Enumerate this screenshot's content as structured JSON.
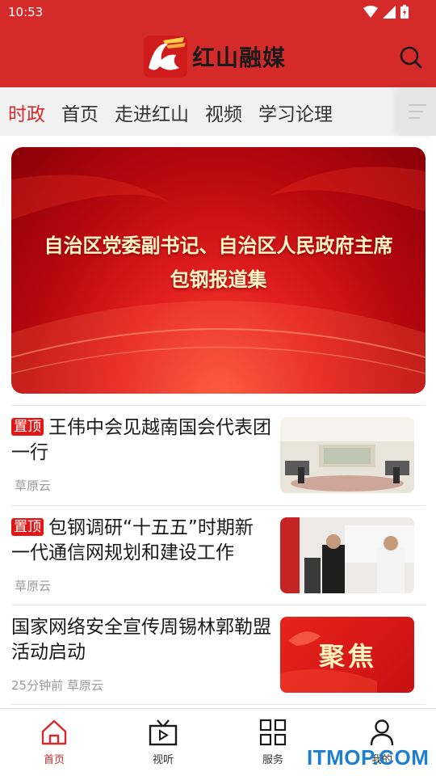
{
  "status_bar": {
    "time": "10:53"
  },
  "header": {
    "app_name": "红山融媒"
  },
  "tabs": [
    {
      "label": "时政",
      "active": true
    },
    {
      "label": "首页",
      "active": false
    },
    {
      "label": "走进红山",
      "active": false
    },
    {
      "label": "视频",
      "active": false
    },
    {
      "label": "学习论理",
      "active": false
    }
  ],
  "banner": {
    "line1": "自治区党委副书记、自治区人民政府主席",
    "line2": "包钢报道集"
  },
  "news": [
    {
      "pin": "置顶",
      "title": "王伟中会见越南国会代表团一行",
      "meta": "草原云"
    },
    {
      "pin": "置顶",
      "title": "包钢调研“十五五”时期新一代通信网规划和建设工作",
      "meta": "草原云"
    },
    {
      "pin": "",
      "title": "国家网络安全宣传周锡林郭勒盟活动启动",
      "meta": "25分钟前 草原云",
      "thumb_text": "聚焦"
    }
  ],
  "bottom_nav": [
    {
      "label": "首页",
      "active": true
    },
    {
      "label": "视听",
      "active": false
    },
    {
      "label": "服务",
      "active": false
    },
    {
      "label": "我的",
      "active": false
    }
  ],
  "watermark": "ITMOP.COM",
  "colors": {
    "brand_red": "#d42a2a",
    "tab_bg": "#f2f2f2"
  }
}
